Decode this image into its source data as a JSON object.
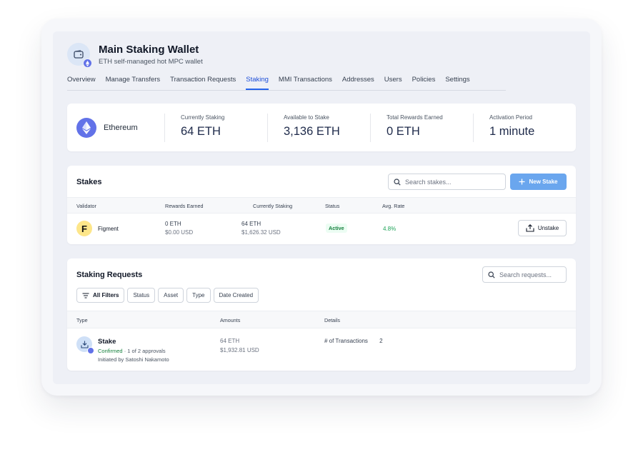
{
  "wallet": {
    "title": "Main Staking Wallet",
    "subtitle": "ETH self-managed hot MPC wallet"
  },
  "tabs": [
    {
      "label": "Overview"
    },
    {
      "label": "Manage Transfers"
    },
    {
      "label": "Transaction Requests"
    },
    {
      "label": "Staking",
      "active": true
    },
    {
      "label": "MMI Transactions"
    },
    {
      "label": "Addresses"
    },
    {
      "label": "Users"
    },
    {
      "label": "Policies"
    },
    {
      "label": "Settings"
    }
  ],
  "summary": {
    "asset": "Ethereum",
    "stats": [
      {
        "label": "Currently Staking",
        "value": "64 ETH"
      },
      {
        "label": "Available to Stake",
        "value": "3,136 ETH"
      },
      {
        "label": "Total Rewards Earned",
        "value": "0 ETH"
      },
      {
        "label": "Activation Period",
        "value": "1 minute"
      }
    ]
  },
  "stakes": {
    "title": "Stakes",
    "search_placeholder": "Search stakes...",
    "new_stake_label": "New Stake",
    "columns": [
      "Validator",
      "Rewards Earned",
      "Currently Staking",
      "Status",
      "Avg. Rate"
    ],
    "rows": [
      {
        "logo_letter": "F",
        "validator": "Figment",
        "rewards": "0 ETH",
        "rewards_usd": "$0.00 USD",
        "staking": "64 ETH",
        "staking_usd": "$1,626.32 USD",
        "status": "Active",
        "rate": "4.8%",
        "action": "Unstake"
      }
    ]
  },
  "requests": {
    "title": "Staking Requests",
    "search_placeholder": "Search requests...",
    "filters": [
      "All Filters",
      "Status",
      "Asset",
      "Type",
      "Date Created"
    ],
    "columns": [
      "Type",
      "Amounts",
      "Details"
    ],
    "rows": [
      {
        "type": "Stake",
        "status": "Confirmed",
        "approvals": " · 1 of 2 approvals",
        "initiated": "Initiated by Satoshi Nakamoto",
        "amount": "64 ETH",
        "amount_usd": "$1,932.81 USD",
        "detail_label": "# of Transactions",
        "detail_value": "2"
      }
    ]
  },
  "colors": {
    "accent": "#2563eb",
    "eth": "#6272e8",
    "primary_button": "#6aa6ee",
    "success": "#22a55b"
  }
}
